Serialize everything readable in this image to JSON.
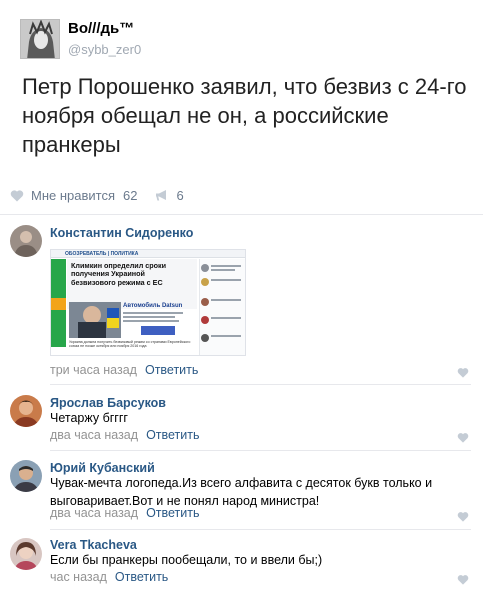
{
  "post": {
    "author": "Во///дь™",
    "handle": "@sybb_zer0",
    "text": "Петр Порошенко заявил, что безвиз с 24-го ноября обещал не он, а российские пранкеры",
    "like_label": "Мне нравится",
    "like_count": "62",
    "repost_count": "6"
  },
  "comments": [
    {
      "author": "Константин Сидоренко",
      "time": "три часа назад",
      "reply": "Ответить",
      "attachment": {
        "site": "ОБОЗРЕВАТЕЛЬ | ПОЛИТИКА",
        "headline": "Климкин определил сроки получения Украиной безвизового режима с ЕС",
        "promo_title": "Автомобиль Datsun",
        "caption": "Украина должна получить безвизовый режим со странами Европейского союза не позже октября или ноября 2016 года"
      }
    },
    {
      "author": "Ярослав Барсуков",
      "text": "Четаржу бгггг",
      "time": "два часа назад",
      "reply": "Ответить"
    },
    {
      "author": "Юрий Кубанский",
      "text": "Чувак-мечта логопеда.Из всего алфавита с десяток букв только и выговаривает.Вот и не понял народ министра!",
      "time": "два часа назад",
      "reply": "Ответить"
    },
    {
      "author": "Vera Tkacheva",
      "text": "Если бы пранкеры пообещали, то и ввели бы;)",
      "time": "час назад",
      "reply": "Ответить"
    }
  ],
  "icons": {
    "like": "heart-icon",
    "repost": "megaphone-icon"
  },
  "colors": {
    "link": "#2a5885",
    "meta": "#939393",
    "action": "#6b7a8d",
    "icon": "#c4ccd5",
    "divider": "#e7e8ec"
  }
}
